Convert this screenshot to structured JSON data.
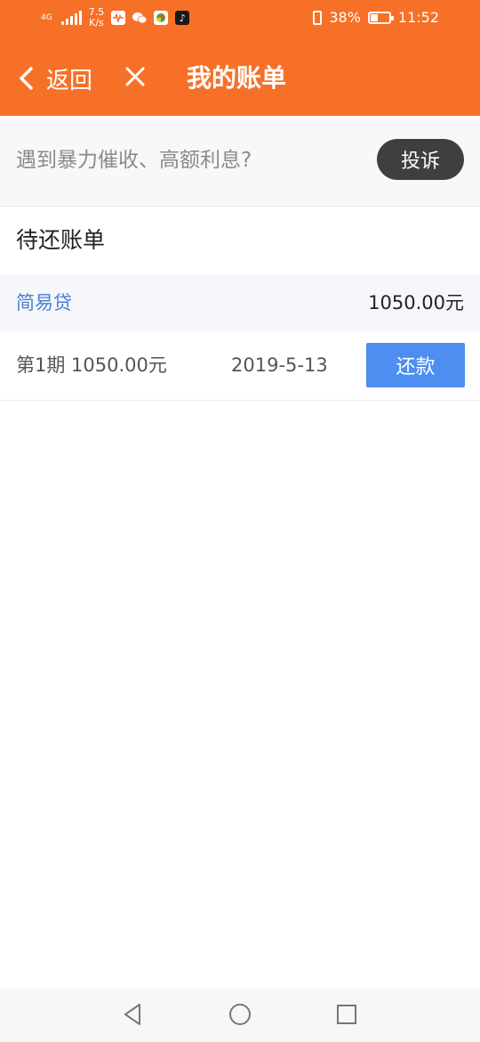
{
  "status_bar": {
    "network_type": "4G",
    "speed_value": "7.5",
    "speed_unit": "K/s",
    "battery_percent": "38%",
    "battery_level": 0.38,
    "time": "11:52"
  },
  "header": {
    "back_label": "返回",
    "title": "我的账单"
  },
  "complaint": {
    "text": "遇到暴力催收、高额利息?",
    "button_label": "投诉"
  },
  "bills": {
    "section_title": "待还账单",
    "loan": {
      "name": "简易贷",
      "amount": "1050.00元"
    },
    "installment": {
      "info": "第1期 1050.00元",
      "date": "2019-5-13",
      "repay_label": "还款"
    }
  },
  "colors": {
    "brand": "#f77028",
    "link": "#4a7fd4",
    "primary_button": "#4d8ef0",
    "dark_button": "#3f3f3f"
  }
}
